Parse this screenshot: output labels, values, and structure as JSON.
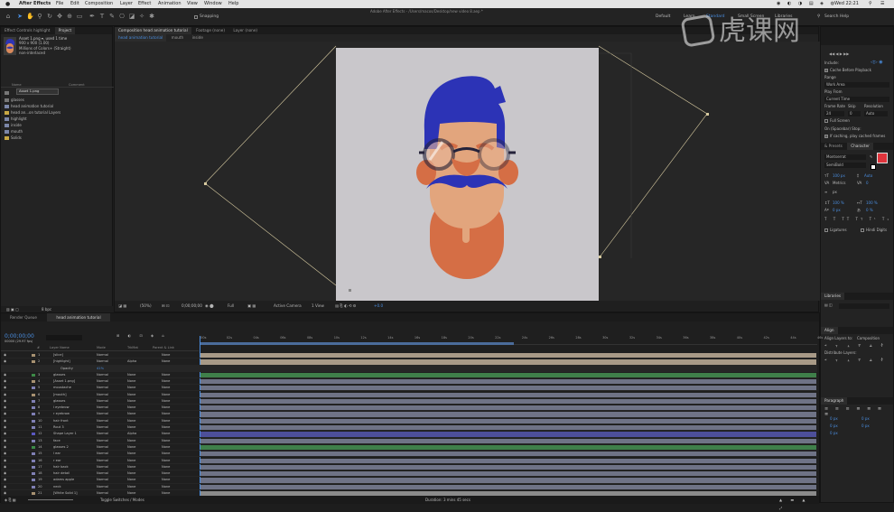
{
  "menubar": {
    "app_name": "After Effects",
    "items": [
      "File",
      "Edit",
      "Composition",
      "Layer",
      "Effect",
      "Animation",
      "View",
      "Window",
      "Help"
    ],
    "clock": "Wed 22:21"
  },
  "toolbar": {
    "snapping": "Snapping",
    "window_title": "Adobe After Effects - /Users/macos/Desktop/new video 8.aep *",
    "workspaces": [
      "Default",
      "Learn",
      "Standard",
      "Small Screen",
      "Libraries"
    ],
    "search_placeholder": "Search Help"
  },
  "project": {
    "tabs": [
      "Effect Controls highlight",
      "Project"
    ],
    "asset_name": "Asset 1.png ▾, used 1 time",
    "asset_size": "900 x 900 (1.00)",
    "asset_color": "Millions of Colors+ (Straight)",
    "asset_interp": "non-interlaced",
    "search_value": "Asset 1.png",
    "col_name": "Name",
    "col_comment": "Comment",
    "items": [
      "Asset 1.png",
      "glasses",
      "head animation tutorial",
      "head an...on tutorial Layers",
      "highlight",
      "inside",
      "mouth",
      "Solids"
    ],
    "bit_depth": "8 bpc"
  },
  "composition": {
    "tabs": [
      "Composition head animation tutorial",
      "Footage (none)",
      "Layer (none)"
    ],
    "breadcrumbs": [
      "head animation tutorial",
      "mouth",
      "inside"
    ],
    "zoom": "(50%)",
    "timecode": "0;00;00;00",
    "resolution": "Full",
    "camera": "Active Camera",
    "views": "1 View",
    "exposure": "+0.0"
  },
  "timeline": {
    "tabs": [
      "Render Queue",
      "head animation tutorial"
    ],
    "current_time": "0;00;00;00",
    "frame_info": "00000 (29.97 fps)",
    "headers": {
      "num": "#",
      "name": "Layer Name",
      "mode": "Mode",
      "trkmat": "TrkMat",
      "parent": "Parent & Link"
    },
    "ruler": [
      ":00s",
      "02s",
      "04s",
      "06s",
      "08s",
      "10s",
      "12s",
      "14s",
      "16s",
      "18s",
      "20s",
      "22s",
      "24s",
      "26s",
      "28s",
      "30s",
      "32s",
      "34s",
      "36s",
      "38s",
      "40s",
      "42s",
      "44s",
      "46s"
    ],
    "opacity_label": "Opacity",
    "opacity_value": "41%",
    "toggle_label": "Toggle Switches / Modes",
    "duration": "Duration: 3 mins 45 secs",
    "layers": [
      {
        "num": "1",
        "name": "[slice]",
        "mode": "Normal",
        "trkmat": "",
        "parent": "None",
        "color": "#a79171",
        "bar": "#a89a87"
      },
      {
        "num": "2",
        "name": "[highlight]",
        "mode": "Normal",
        "trkmat": "Alpha",
        "parent": "None",
        "color": "#a79171",
        "bar": "#a89a87"
      },
      {
        "num": "3",
        "name": "glasses",
        "mode": "Normal",
        "trkmat": "None",
        "parent": "None",
        "color": "#3c8a47",
        "bar": "#3f7f4a"
      },
      {
        "num": "4",
        "name": "[Asset 1.png]",
        "mode": "Normal",
        "trkmat": "None",
        "parent": "None",
        "color": "#a79171",
        "bar": "#6f7386"
      },
      {
        "num": "5",
        "name": "moustache",
        "mode": "Normal",
        "trkmat": "None",
        "parent": "None",
        "color": "#7f7fb3",
        "bar": "#6f7386"
      },
      {
        "num": "6",
        "name": "[mouth]",
        "mode": "Normal",
        "trkmat": "None",
        "parent": "None",
        "color": "#a79171",
        "bar": "#6f7386"
      },
      {
        "num": "7",
        "name": "glasses",
        "mode": "Normal",
        "trkmat": "None",
        "parent": "None",
        "color": "#7f7fb3",
        "bar": "#6f7386"
      },
      {
        "num": "8",
        "name": "l eyebrow",
        "mode": "Normal",
        "trkmat": "None",
        "parent": "None",
        "color": "#7f7fb3",
        "bar": "#6f7386"
      },
      {
        "num": "9",
        "name": "r eyebrow",
        "mode": "Normal",
        "trkmat": "None",
        "parent": "None",
        "color": "#7f7fb3",
        "bar": "#6f7386"
      },
      {
        "num": "10",
        "name": "hair front",
        "mode": "Normal",
        "trkmat": "None",
        "parent": "None",
        "color": "#7f7fb3",
        "bar": "#6f7386"
      },
      {
        "num": "11",
        "name": "Rout 3",
        "mode": "Normal",
        "trkmat": "None",
        "parent": "None",
        "color": "#7f7fb3",
        "bar": "#6f7386"
      },
      {
        "num": "12",
        "name": "Shape Layer 1",
        "mode": "Normal",
        "trkmat": "Alpha",
        "parent": "None",
        "color": "#5a57c0",
        "bar": "#4d4f9a"
      },
      {
        "num": "13",
        "name": "face",
        "mode": "Normal",
        "trkmat": "None",
        "parent": "None",
        "color": "#7f7fb3",
        "bar": "#6f7386"
      },
      {
        "num": "14",
        "name": "glasses 2",
        "mode": "Normal",
        "trkmat": "None",
        "parent": "None",
        "color": "#3c8a47",
        "bar": "#3f7f4a"
      },
      {
        "num": "15",
        "name": "l ear",
        "mode": "Normal",
        "trkmat": "None",
        "parent": "None",
        "color": "#7f7fb3",
        "bar": "#6f7386"
      },
      {
        "num": "16",
        "name": "r ear",
        "mode": "Normal",
        "trkmat": "None",
        "parent": "None",
        "color": "#7f7fb3",
        "bar": "#6f7386"
      },
      {
        "num": "17",
        "name": "hair back",
        "mode": "Normal",
        "trkmat": "None",
        "parent": "None",
        "color": "#7f7fb3",
        "bar": "#6f7386"
      },
      {
        "num": "18",
        "name": "hair detail",
        "mode": "Normal",
        "trkmat": "None",
        "parent": "None",
        "color": "#7f7fb3",
        "bar": "#6f7386"
      },
      {
        "num": "19",
        "name": "adams apple",
        "mode": "Normal",
        "trkmat": "None",
        "parent": "None",
        "color": "#7f7fb3",
        "bar": "#6f7386"
      },
      {
        "num": "20",
        "name": "neck",
        "mode": "Normal",
        "trkmat": "None",
        "parent": "None",
        "color": "#7f7fb3",
        "bar": "#6f7386"
      },
      {
        "num": "21",
        "name": "[White Solid 1]",
        "mode": "Normal",
        "trkmat": "None",
        "parent": "None",
        "color": "#a79171",
        "bar": "#8b8b8b"
      }
    ]
  },
  "right_panel": {
    "preview": {
      "include": "Include:",
      "cache": "Cache Before Playback",
      "range_label": "Range",
      "range_value": "Work Area",
      "play_from_label": "Play From",
      "play_from_value": "Current Time",
      "frame_rate_label": "Frame Rate",
      "skip_label": "Skip",
      "resolution_label": "Resolution",
      "frame_rate": "24",
      "skip": "0",
      "resolution": "Auto",
      "full_screen": "Full Screen",
      "on_stop": "On (Spacebar) Stop:",
      "if_caching": "If caching, play cached frames"
    },
    "character": {
      "tabs": [
        "& Presets",
        "Character"
      ],
      "font": "Montserrat",
      "style": "SemiBold",
      "size": "100 px",
      "leading": "Auto",
      "tracking_metric": "Metrics",
      "tracking": "0",
      "stroke_unit": "px",
      "scale_v": "100 %",
      "scale_h": "100 %",
      "baseline": "0 px",
      "tsume": "0 %",
      "ligatures": "Ligatures",
      "hindi": "Hindi Digits",
      "color": "#e0343c"
    },
    "libraries": {
      "title": "Libraries"
    },
    "align": {
      "title": "Align",
      "align_to_label": "Align Layers to:",
      "align_to_value": "Composition",
      "distribute": "Distribute Layers:"
    },
    "paragraph": {
      "title": "Paragraph",
      "values": [
        "0 px",
        "0 px",
        "0 px",
        "0 px",
        "0 px"
      ]
    }
  },
  "watermark": {
    "text": "虎课网"
  }
}
